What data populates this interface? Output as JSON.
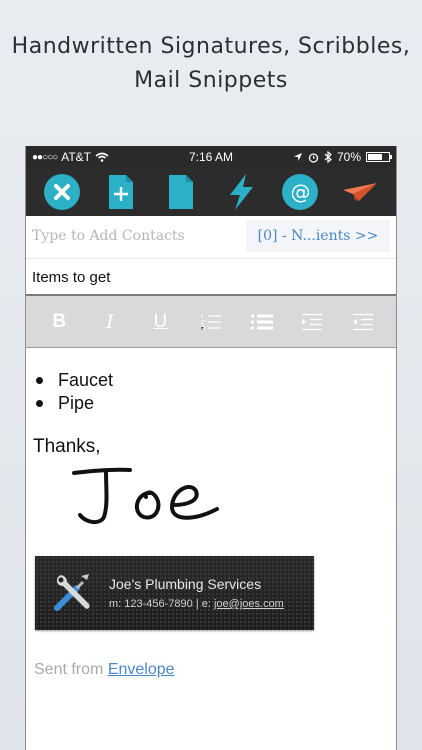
{
  "headline": {
    "line1": "Handwritten Signatures, Scribbles,",
    "line2": "Mail Snippets"
  },
  "status_bar": {
    "signal": "●●○○○",
    "carrier": "AT&T",
    "time": "7:16 AM",
    "battery": "70%",
    "battery_level": 0.7
  },
  "toolbar": {
    "buttons": [
      "close-icon",
      "new-document-icon",
      "document-icon",
      "lightning-icon",
      "at-sign-icon",
      "paper-plane-icon"
    ],
    "accent_color": "#2bb0c7",
    "send_color": "#e8603c"
  },
  "compose": {
    "to_placeholder": "Type to Add Contacts",
    "recipients_label": "[0] - N...ients >>",
    "subject": "Items to get"
  },
  "format_bar": {
    "bold": "B",
    "italic": "I",
    "underline": "U"
  },
  "message": {
    "items": [
      "Faucet",
      "Pipe"
    ],
    "closing": "Thanks,",
    "signature": "Joe",
    "card": {
      "name": "Joe's Plumbing Services",
      "phone_prefix": "m: 123-456-7890 | e: ",
      "email": "joe@joes.com"
    },
    "footer_prefix": "Sent from ",
    "footer_link": "Envelope"
  }
}
